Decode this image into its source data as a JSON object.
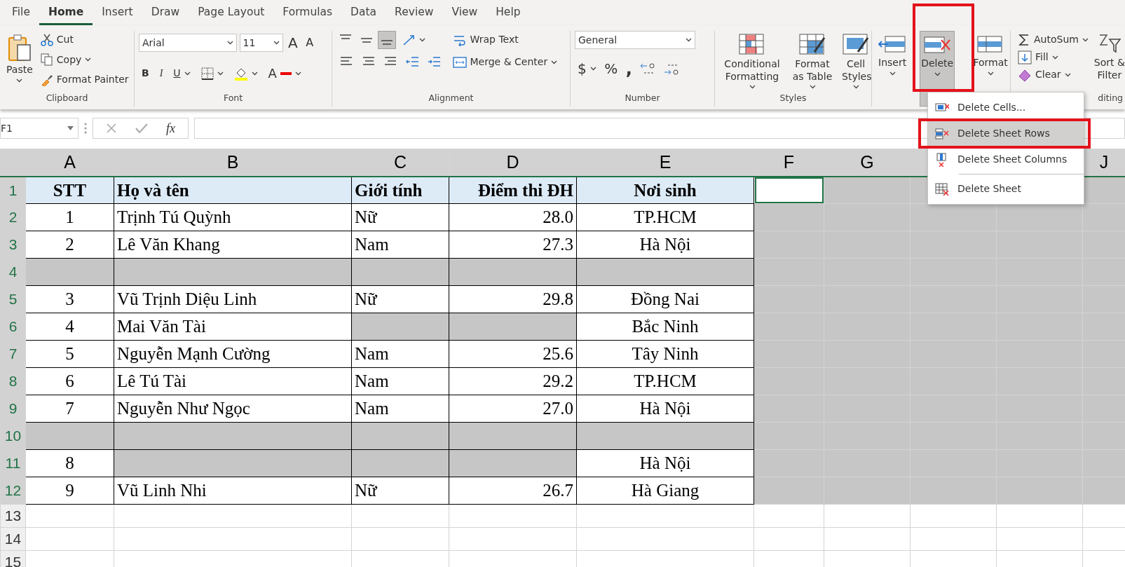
{
  "menu_tabs": [
    {
      "label": "File",
      "selected": false
    },
    {
      "label": "Home",
      "selected": true
    },
    {
      "label": "Insert",
      "selected": false
    },
    {
      "label": "Draw",
      "selected": false
    },
    {
      "label": "Page Layout",
      "selected": false
    },
    {
      "label": "Formulas",
      "selected": false
    },
    {
      "label": "Data",
      "selected": false
    },
    {
      "label": "Review",
      "selected": false
    },
    {
      "label": "View",
      "selected": false
    },
    {
      "label": "Help",
      "selected": false
    }
  ],
  "ribbon": {
    "clipboard": {
      "label": "Clipboard",
      "paste": "Paste",
      "cut": "Cut",
      "copy": "Copy",
      "format_painter": "Format Painter"
    },
    "font": {
      "label": "Font",
      "name": "Arial",
      "size": "11",
      "grow": "A",
      "shrink": "A",
      "bold": "B",
      "italic": "I",
      "underline": "U",
      "font_color": "A"
    },
    "alignment": {
      "label": "Alignment",
      "vertical_align": [
        {
          "selected": false
        },
        {
          "selected": false
        },
        {
          "selected": true
        }
      ],
      "wrap_text": "Wrap Text",
      "merge": "Merge & Center"
    },
    "number": {
      "label": "Number",
      "format": "General",
      "currency": "$",
      "percent": "%",
      "comma": ","
    },
    "styles": {
      "label": "Styles",
      "items": [
        "Conditional Formatting",
        "Format as Table",
        "Cell Styles"
      ]
    },
    "cells": {
      "items": [
        {
          "label": "Insert",
          "pressed": false
        },
        {
          "label": "Delete",
          "pressed": true
        },
        {
          "label": "Format",
          "pressed": false
        }
      ]
    },
    "editing": {
      "label": "diting",
      "autosum": "AutoSum",
      "fill": "Fill",
      "clear": "Clear",
      "sort_filter": "Sort & Filter"
    }
  },
  "delete_menu": [
    {
      "label": "Delete Cells...",
      "selected": false
    },
    {
      "label": "Delete Sheet Rows",
      "selected": true
    },
    {
      "label": "Delete Sheet Columns",
      "selected": false
    },
    {
      "label": "Delete Sheet",
      "selected": false
    }
  ],
  "formula_bar": {
    "name_box": "F1",
    "fx": "fx"
  },
  "sheet": {
    "columns": [
      {
        "label": "A"
      },
      {
        "label": "B"
      },
      {
        "label": "C"
      },
      {
        "label": "D"
      },
      {
        "label": "E"
      },
      {
        "label": "F"
      },
      {
        "label": "G"
      },
      {},
      {},
      {
        "label": "J"
      }
    ],
    "rows": [
      {
        "header": "1",
        "selected": true,
        "kind": "header",
        "cells": [
          {
            "text": "STT",
            "selected": false
          },
          {
            "text": "Họ và tên",
            "selected": false
          },
          {
            "text": "Giới tính",
            "selected": false
          },
          {
            "text": "Điểm thi ĐH",
            "selected": false
          },
          {
            "text": "Nơi sinh",
            "selected": false
          },
          {
            "active": true
          }
        ]
      },
      {
        "header": "2",
        "selected": true,
        "kind": "data",
        "cells": [
          {
            "text": "1",
            "selected": false
          },
          {
            "text": "Trịnh Tú Quỳnh",
            "selected": false
          },
          {
            "text": "Nữ",
            "selected": false
          },
          {
            "text": "28.0",
            "selected": false
          },
          {
            "text": "TP.HCM",
            "selected": false
          }
        ]
      },
      {
        "header": "3",
        "selected": true,
        "kind": "data",
        "cells": [
          {
            "text": "2",
            "selected": false
          },
          {
            "text": "Lê Văn Khang",
            "selected": false
          },
          {
            "text": "Nam",
            "selected": false
          },
          {
            "text": "27.3",
            "selected": false
          },
          {
            "text": "Hà Nội",
            "selected": false
          }
        ]
      },
      {
        "header": "4",
        "selected": true,
        "kind": "data",
        "cells": [
          {
            "selected": true
          },
          {
            "selected": true
          },
          {
            "selected": true
          },
          {
            "selected": true
          },
          {
            "selected": true
          }
        ]
      },
      {
        "header": "5",
        "selected": true,
        "kind": "data",
        "cells": [
          {
            "text": "3",
            "selected": false
          },
          {
            "text": "Vũ Trịnh Diệu Linh",
            "selected": false
          },
          {
            "text": "Nữ",
            "selected": false
          },
          {
            "text": "29.8",
            "selected": false
          },
          {
            "text": "Đồng Nai",
            "selected": false
          }
        ]
      },
      {
        "header": "6",
        "selected": true,
        "kind": "data",
        "cells": [
          {
            "text": "4",
            "selected": false
          },
          {
            "text": "Mai Văn Tài",
            "selected": false
          },
          {
            "selected": true
          },
          {
            "selected": true
          },
          {
            "text": "Bắc Ninh",
            "selected": false
          }
        ]
      },
      {
        "header": "7",
        "selected": true,
        "kind": "data",
        "cells": [
          {
            "text": "5",
            "selected": false
          },
          {
            "text": "Nguyễn Mạnh Cường",
            "selected": false
          },
          {
            "text": "Nam",
            "selected": false
          },
          {
            "text": "25.6",
            "selected": false
          },
          {
            "text": "Tây Ninh",
            "selected": false
          }
        ]
      },
      {
        "header": "8",
        "selected": true,
        "kind": "data",
        "cells": [
          {
            "text": "6",
            "selected": false
          },
          {
            "text": "Lê Tú Tài",
            "selected": false
          },
          {
            "text": "Nam",
            "selected": false
          },
          {
            "text": "29.2",
            "selected": false
          },
          {
            "text": "TP.HCM",
            "selected": false
          }
        ]
      },
      {
        "header": "9",
        "selected": true,
        "kind": "data",
        "cells": [
          {
            "text": "7",
            "selected": false
          },
          {
            "text": "Nguyễn Như Ngọc",
            "selected": false
          },
          {
            "text": "Nam",
            "selected": false
          },
          {
            "text": "27.0",
            "selected": false
          },
          {
            "text": "Hà Nội",
            "selected": false
          }
        ]
      },
      {
        "header": "10",
        "selected": true,
        "kind": "data",
        "cells": [
          {
            "selected": true
          },
          {
            "selected": true
          },
          {
            "selected": true
          },
          {
            "selected": true
          },
          {
            "selected": true
          }
        ]
      },
      {
        "header": "11",
        "selected": true,
        "kind": "data",
        "cells": [
          {
            "text": "8",
            "selected": false
          },
          {
            "selected": true
          },
          {
            "selected": true
          },
          {
            "selected": true
          },
          {
            "text": "Hà Nội",
            "selected": false
          }
        ]
      },
      {
        "header": "12",
        "selected": true,
        "kind": "data",
        "cells": [
          {
            "text": "9",
            "selected": false
          },
          {
            "text": "Vũ Linh Nhi",
            "selected": false
          },
          {
            "text": "Nữ",
            "selected": false
          },
          {
            "text": "26.7",
            "selected": false
          },
          {
            "text": "Hà Giang",
            "selected": false
          }
        ]
      },
      {
        "header": "13",
        "selected": false,
        "kind": "empty",
        "cells": []
      },
      {
        "header": "14",
        "selected": false,
        "kind": "empty",
        "cells": []
      },
      {
        "header": "15",
        "selected": false,
        "kind": "empty",
        "cells": []
      }
    ]
  }
}
